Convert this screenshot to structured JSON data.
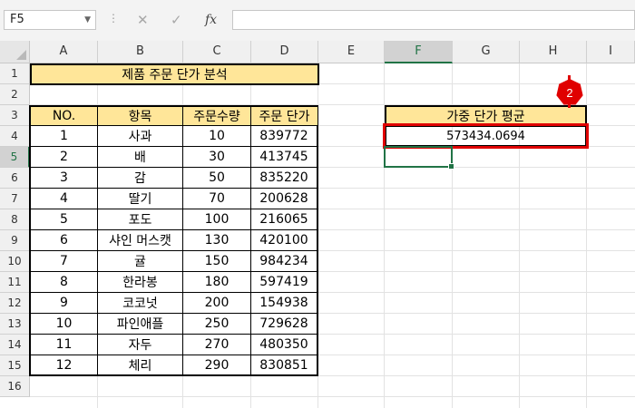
{
  "formula_bar": {
    "name_box": "F5",
    "cancel_icon": "✕",
    "enter_icon": "✓",
    "function_label": "fx",
    "formula": ""
  },
  "columns": [
    "A",
    "B",
    "C",
    "D",
    "E",
    "F",
    "G",
    "H",
    "I"
  ],
  "rows": [
    "1",
    "2",
    "3",
    "4",
    "5",
    "6",
    "7",
    "8",
    "9",
    "10",
    "11",
    "12",
    "13",
    "14",
    "15",
    "16"
  ],
  "sheet": {
    "title": "제품 주문 단가 분석",
    "headers": [
      "NO.",
      "항목",
      "주문수량",
      "주문 단가"
    ],
    "data": [
      [
        "1",
        "사과",
        "10",
        "839772"
      ],
      [
        "2",
        "배",
        "30",
        "413745"
      ],
      [
        "3",
        "감",
        "50",
        "835220"
      ],
      [
        "4",
        "딸기",
        "70",
        "200628"
      ],
      [
        "5",
        "포도",
        "100",
        "216065"
      ],
      [
        "6",
        "샤인 머스캣",
        "130",
        "420100"
      ],
      [
        "7",
        "귤",
        "150",
        "984234"
      ],
      [
        "8",
        "한라봉",
        "180",
        "597419"
      ],
      [
        "9",
        "코코넛",
        "200",
        "154938"
      ],
      [
        "10",
        "파인애플",
        "250",
        "729628"
      ],
      [
        "11",
        "자두",
        "270",
        "480350"
      ],
      [
        "12",
        "체리",
        "290",
        "830851"
      ]
    ],
    "result_label": "가중 단가 평균",
    "result_value": "573434.0694"
  },
  "annotation": {
    "badge": "2",
    "color": "#e00000"
  },
  "colors": {
    "header_fill": "#ffe699",
    "selection": "#217346"
  }
}
